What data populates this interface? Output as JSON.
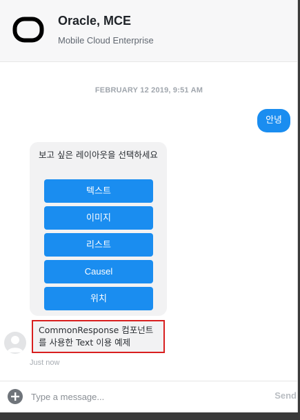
{
  "header": {
    "title": "Oracle, MCE",
    "subtitle": "Mobile Cloud Enterprise",
    "logo_icon": "oracle-logo-icon"
  },
  "conversation": {
    "timestamp": "FEBRUARY 12 2019, 9:51 AM",
    "user_message": "안녕",
    "bot_prompt": "보고 싶은 레이아웃을 선택하세요",
    "choices": [
      "텍스트",
      "이미지",
      "리스트",
      "Causel",
      "위치"
    ],
    "bot_text": "CommonResponse 컴포넌트를 사용한 Text 이용 예제",
    "bot_time": "Just now"
  },
  "composer": {
    "placeholder": "Type a message...",
    "send_label": "Send",
    "add_icon": "plus-circle-icon"
  },
  "colors": {
    "accent": "#1a8df0",
    "highlight_border": "#d81e1e",
    "header_bg": "#f7f7f8",
    "bubble_bg": "#f2f2f3"
  }
}
